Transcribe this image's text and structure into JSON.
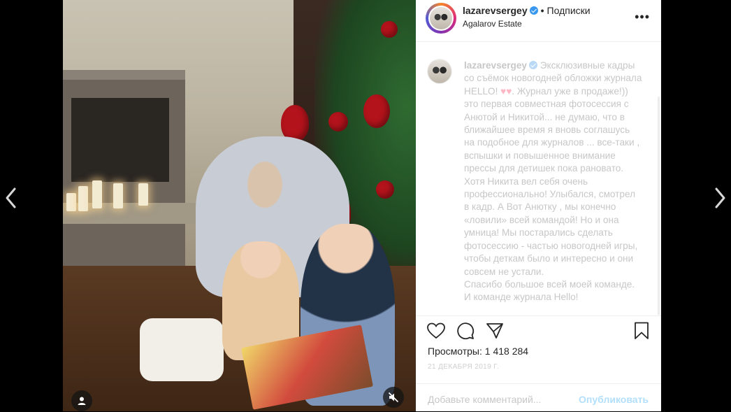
{
  "post": {
    "username": "lazarevsergey",
    "follow_label": "Подписки",
    "location": "Agalarov Estate",
    "more_label": "•••"
  },
  "caption": {
    "username": "lazarevsergey",
    "text_part1": "Эксклюзивные кадры со съёмок новогодней обложки журнала HELLO!",
    "hearts": "♥♥",
    "text_part2": ". Журнал уже в продаже!)) это первая совместная фотосессия с Анютой и Никитой... не думаю, что в ближайшее время я вновь соглашусь на подобное для журналов ... все-таки , вспышки и повышенное внимание прессы для детишек пока рановато. Хотя Никита вел себя очень профессионально! Улыбался, смотрел в кадр. А Вот Анютку , мы конечно «ловили» всей командой! Но и она умница! Мы постарались сделать фотосессию - частью новогодней игры, чтобы деткам было и интересно и они совсем не устали.",
    "text_part3": "Спасибо большое всей моей команде. И команде журнала Hello!"
  },
  "stats": {
    "views": "Просмотры: 1 418 284",
    "date": "21 декабря 2019 г."
  },
  "comment": {
    "placeholder": "Добавьте комментарий...",
    "publish_label": "Опубликовать"
  },
  "icons": {
    "nav_left": "chevron-left-icon",
    "nav_right": "chevron-right-icon",
    "like": "heart-icon",
    "comment": "comment-icon",
    "share": "paper-plane-icon",
    "save": "bookmark-icon",
    "tagged": "user-tag-icon",
    "mute": "muted-speaker-icon"
  },
  "colors": {
    "verified": "#3897f0",
    "publish_disabled": "#b2dffc",
    "caption_faded": "#c7c7c7"
  }
}
